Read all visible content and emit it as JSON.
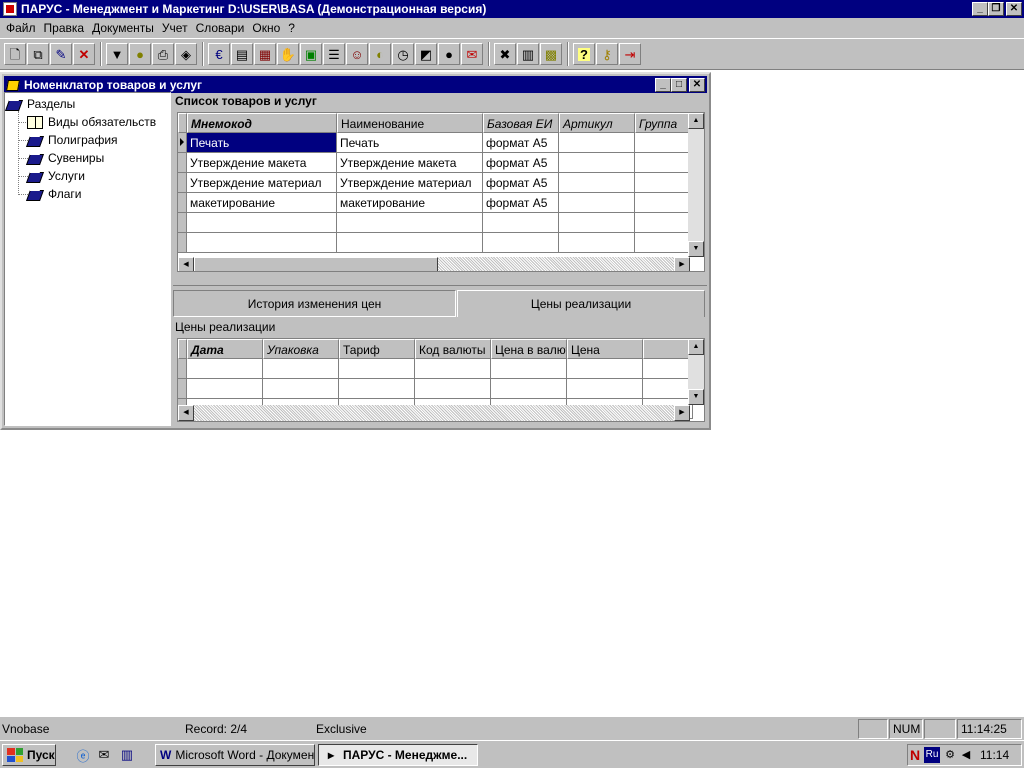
{
  "titlebar": {
    "title": "ПАРУС - Менеджмент и Маркетинг  D:\\USER\\BASA (Демонстрационная версия)"
  },
  "menu": {
    "items": [
      "Файл",
      "Правка",
      "Документы",
      "Учет",
      "Словари",
      "Окно",
      "?"
    ]
  },
  "toolbar": {
    "groups": [
      [
        "new-doc-icon",
        "copy-doc-icon",
        "edit-doc-icon",
        "delete-icon"
      ],
      [
        "filter-icon",
        "find-icon",
        "print-icon",
        "export-icon"
      ],
      [
        "currency-icon",
        "book-icon",
        "catalog-icon",
        "handshake-icon",
        "calc-icon",
        "report-icon",
        "people-icon",
        "stamp-icon",
        "clock-icon",
        "chart-icon",
        "bomb-icon",
        "mail-icon"
      ],
      [
        "tools-icon",
        "calculator-icon",
        "calendar-icon",
        "help-icon",
        "key-icon",
        "exit-icon"
      ]
    ]
  },
  "child_window": {
    "title": "Номенклатор товаров и услуг"
  },
  "tree": {
    "root": "Разделы",
    "items": [
      "Виды обязательств",
      "Полиграфия",
      "Сувениры",
      "Услуги",
      "Флаги"
    ]
  },
  "list": {
    "caption": "Список товаров и услуг",
    "columns": [
      "Мнемокод",
      "Наименование",
      "Базовая ЕИ",
      "Артикул",
      "Группа"
    ],
    "rows": [
      [
        "Печать",
        "Печать",
        "формат А5",
        "",
        ""
      ],
      [
        "Утверждение макета",
        "Утверждение макета",
        "формат А5",
        "",
        ""
      ],
      [
        "Утверждение материал",
        "Утверждение материал",
        "формат А5",
        "",
        ""
      ],
      [
        "макетирование",
        "макетирование",
        "формат А5",
        "",
        ""
      ]
    ],
    "selected_row": 0
  },
  "tabs": {
    "items": [
      "История изменения цен",
      "Цены реализации"
    ],
    "active": 1
  },
  "prices": {
    "caption": "Цены реализации",
    "columns": [
      "Дата",
      "Упаковка",
      "Тариф",
      "Код валюты",
      "Цена в валют",
      "Цена"
    ]
  },
  "statusbar": {
    "db": "Vnobase",
    "record": "Record: 2/4",
    "mode": "Exclusive",
    "num": "NUM",
    "time": "11:14:25"
  },
  "taskbar": {
    "start": "Пуск",
    "tasks": [
      "Microsoft Word - Докумен...",
      "ПАРУС - Менеджме..."
    ],
    "tray_lang": "Ru",
    "clock": "11:14"
  }
}
